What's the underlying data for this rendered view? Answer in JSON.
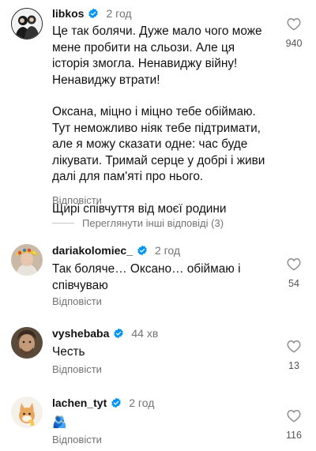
{
  "comments": [
    {
      "username": "libkos",
      "time": "2 год",
      "paragraphs": [
        "Це так болячи. Дуже мало чого може мене пробити на сльози. Але ця історія змогла. Ненавиджу війну! Ненавиджу втрати!",
        "Оксана, міцно і міцно тебе обіймаю. Тут неможливо ніяк тебе підтримати, але я можу сказати одне: час буде лікувати. Тримай серце у добрі і живи далі для пам'яті про нього.",
        "Щирі співчуття від моєї родини"
      ],
      "reply_label": "Відповісти",
      "likes": "940",
      "view_replies": "Переглянути інші відповіді (3)"
    },
    {
      "username": "dariakolomiec_",
      "time": "2 год",
      "paragraphs": [
        "Так боляче… Оксано… обіймаю і співчуваю"
      ],
      "reply_label": "Відповісти",
      "likes": "54"
    },
    {
      "username": "vyshebaba",
      "time": "44 хв",
      "paragraphs": [
        "Честь"
      ],
      "reply_label": "Відповісти",
      "likes": "13"
    },
    {
      "username": "lachen_tyt",
      "time": "2 год",
      "paragraphs": [
        "🫂"
      ],
      "reply_label": "Відповісти",
      "likes": "116"
    }
  ],
  "colors": {
    "verified": "#0095f6",
    "secondary_text": "#737373"
  },
  "icons": {
    "verified": "verified-badge-icon",
    "like": "heart-outline-icon"
  }
}
